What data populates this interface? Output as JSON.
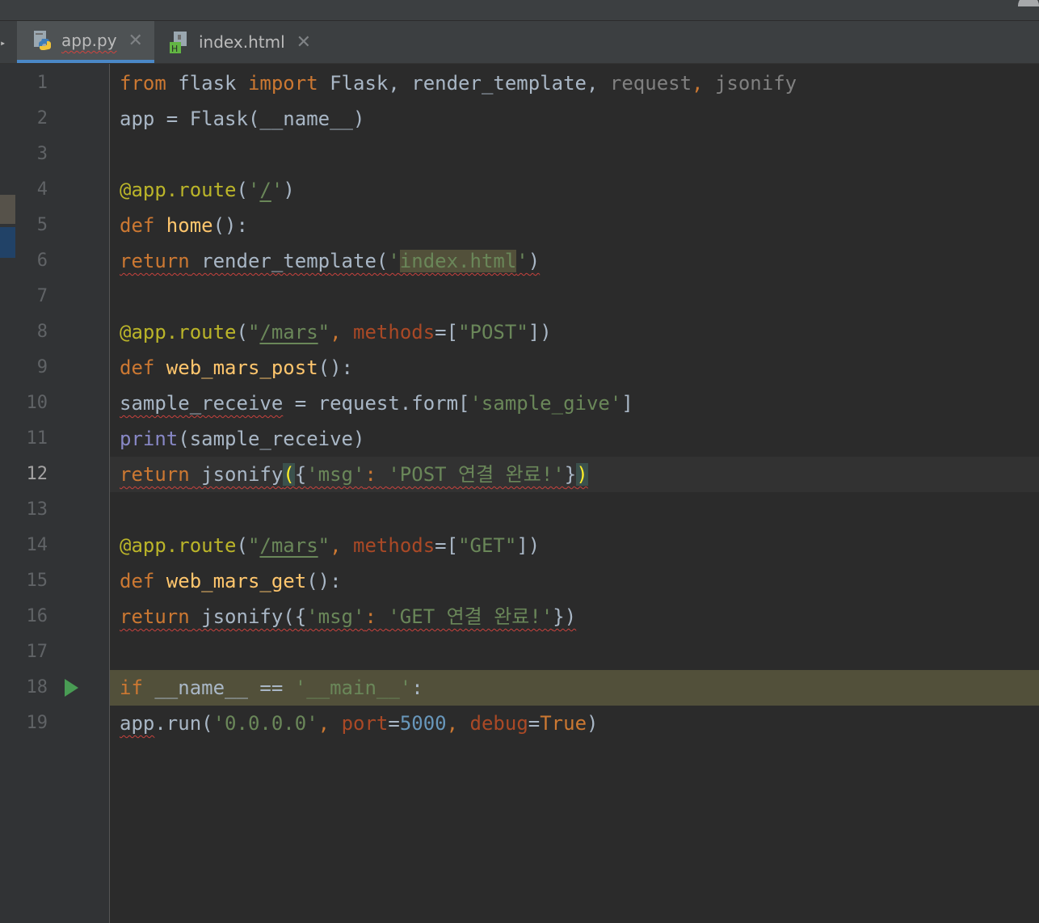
{
  "tabs": [
    {
      "label": "app.py",
      "active": true,
      "icon": "python-file-icon"
    },
    {
      "label": "index.html",
      "active": false,
      "icon": "html-file-icon"
    }
  ],
  "close_glyph": "✕",
  "lines": [
    {
      "n": "1"
    },
    {
      "n": "2"
    },
    {
      "n": "3"
    },
    {
      "n": "4"
    },
    {
      "n": "5"
    },
    {
      "n": "6"
    },
    {
      "n": "7"
    },
    {
      "n": "8"
    },
    {
      "n": "9"
    },
    {
      "n": "10"
    },
    {
      "n": "11"
    },
    {
      "n": "12"
    },
    {
      "n": "13"
    },
    {
      "n": "14"
    },
    {
      "n": "15"
    },
    {
      "n": "16"
    },
    {
      "n": "17"
    },
    {
      "n": "18"
    },
    {
      "n": "19"
    }
  ],
  "current_line": "12",
  "colors": {
    "keyword": "#cc7832",
    "string": "#6a8759",
    "function": "#ffc66d",
    "decorator": "#bbb529",
    "number": "#6897bb",
    "error_underline": "#c8423d",
    "run_icon": "#499c54",
    "tab_underline": "#4a88c7"
  },
  "code": {
    "l1": {
      "kw_from": "from",
      "mod": " flask ",
      "kw_import": "import",
      "names": " Flask, render_template, ",
      "unused1": "request",
      "sep": ", ",
      "unused2": "jsonify"
    },
    "l2": {
      "text": "app = Flask(__name__)"
    },
    "l4": {
      "dec": "@app.route",
      "p1": "(",
      "s1": "'",
      "s2": "/",
      "s3": "'",
      "p2": ")"
    },
    "l5": {
      "kw": "def",
      "fn": " home",
      "rest": "():"
    },
    "l6": {
      "kw": "return",
      "mid": " render_template(",
      "q1": "'",
      "arg": "index.html",
      "q2": "'",
      "end": ")"
    },
    "l8": {
      "dec": "@app.route",
      "p1": "(",
      "s1": "\"",
      "s2": "/mars",
      "s3": "\"",
      "c": ", ",
      "param": "methods",
      "eq": "=[",
      "s4": "\"POST\"",
      "end": "])"
    },
    "l9": {
      "kw": "def",
      "fn": " web_mars_post",
      "rest": "():"
    },
    "l10": {
      "v": "sample_receive",
      "mid": " = request.form[",
      "s": "'sample_give'",
      "end": "]"
    },
    "l11": {
      "b": "print",
      "rest": "(sample_receive)"
    },
    "l12": {
      "kw": "return",
      "mid": " jsonify",
      "o": "(",
      "br": "{",
      "s1": "'msg'",
      "c": ": ",
      "s2": "'POST 연결 완료!'",
      "cb": "}",
      "cl": ")"
    },
    "l14": {
      "dec": "@app.route",
      "p1": "(",
      "s1": "\"",
      "s2": "/mars",
      "s3": "\"",
      "c": ", ",
      "param": "methods",
      "eq": "=[",
      "s4": "\"GET\"",
      "end": "])"
    },
    "l15": {
      "kw": "def",
      "fn": " web_mars_get",
      "rest": "():"
    },
    "l16": {
      "kw": "return",
      "mid": " jsonify({",
      "s1": "'msg'",
      "c": ": ",
      "s2": "'GET 연결 완료!'",
      "end": "})"
    },
    "l18": {
      "kw": "if",
      "mid": " __name__ == ",
      "s": "'__main__'",
      "end": ":"
    },
    "l19": {
      "a": "app",
      "b": ".run(",
      "s": "'0.0.0.0'",
      "c": ", ",
      "p1": "port",
      "eq1": "=",
      "num": "5000",
      "c2": ", ",
      "p2": "debug",
      "eq2": "=",
      "kwT": "True",
      "end": ")"
    }
  }
}
